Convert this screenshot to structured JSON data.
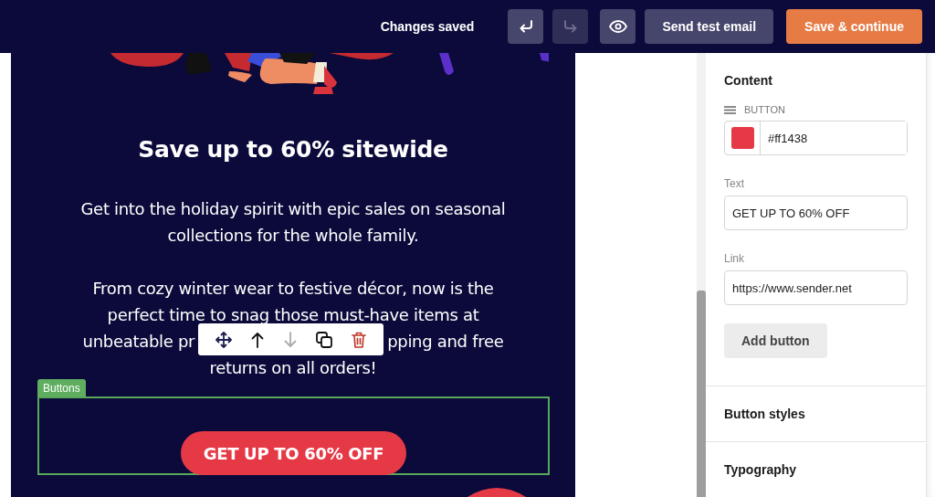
{
  "top_bar": {
    "status": "Changes saved",
    "actions": [
      {
        "kind": "undo",
        "disabled": false
      },
      {
        "kind": "redo",
        "disabled": true
      },
      {
        "kind": "preview",
        "disabled": false
      },
      {
        "kind": "text",
        "label": "Send test email",
        "disabled": false
      },
      {
        "kind": "primary",
        "label": "Save & continue",
        "disabled": false
      }
    ]
  },
  "email": {
    "heading": "Save up to 60% sitewide",
    "paragraph_1": "Get into the holiday spirit with epic sales on seasonal collections for the whole family.",
    "paragraph_2_lines": [
      "From cozy winter wear to festive décor, now is the",
      "perfect time to snag those must-have items at"
    ],
    "paragraph_2_covered_left": "unbeatable pr",
    "paragraph_2_covered_right": "pping and free",
    "paragraph_2_last": "returns on all orders!",
    "block_label": "Buttons",
    "cta": "GET UP TO 60% OFF",
    "block_toolbar": [
      {
        "kind": "move",
        "disabled": false
      },
      {
        "kind": "up",
        "disabled": false
      },
      {
        "kind": "down",
        "disabled": true
      },
      {
        "kind": "duplicate",
        "disabled": false
      },
      {
        "kind": "delete",
        "disabled": false
      }
    ]
  },
  "sidebar": {
    "section_title": "Content",
    "item_label": "BUTTON",
    "color_value": "#ff1438",
    "color": "#e63946",
    "text_label": "Text",
    "text_value": "GET UP TO 60% OFF",
    "link_label": "Link",
    "link_value": "https://www.sender.net",
    "add_button": "Add button",
    "collapsed_sections": [
      "Button styles",
      "Typography"
    ]
  }
}
